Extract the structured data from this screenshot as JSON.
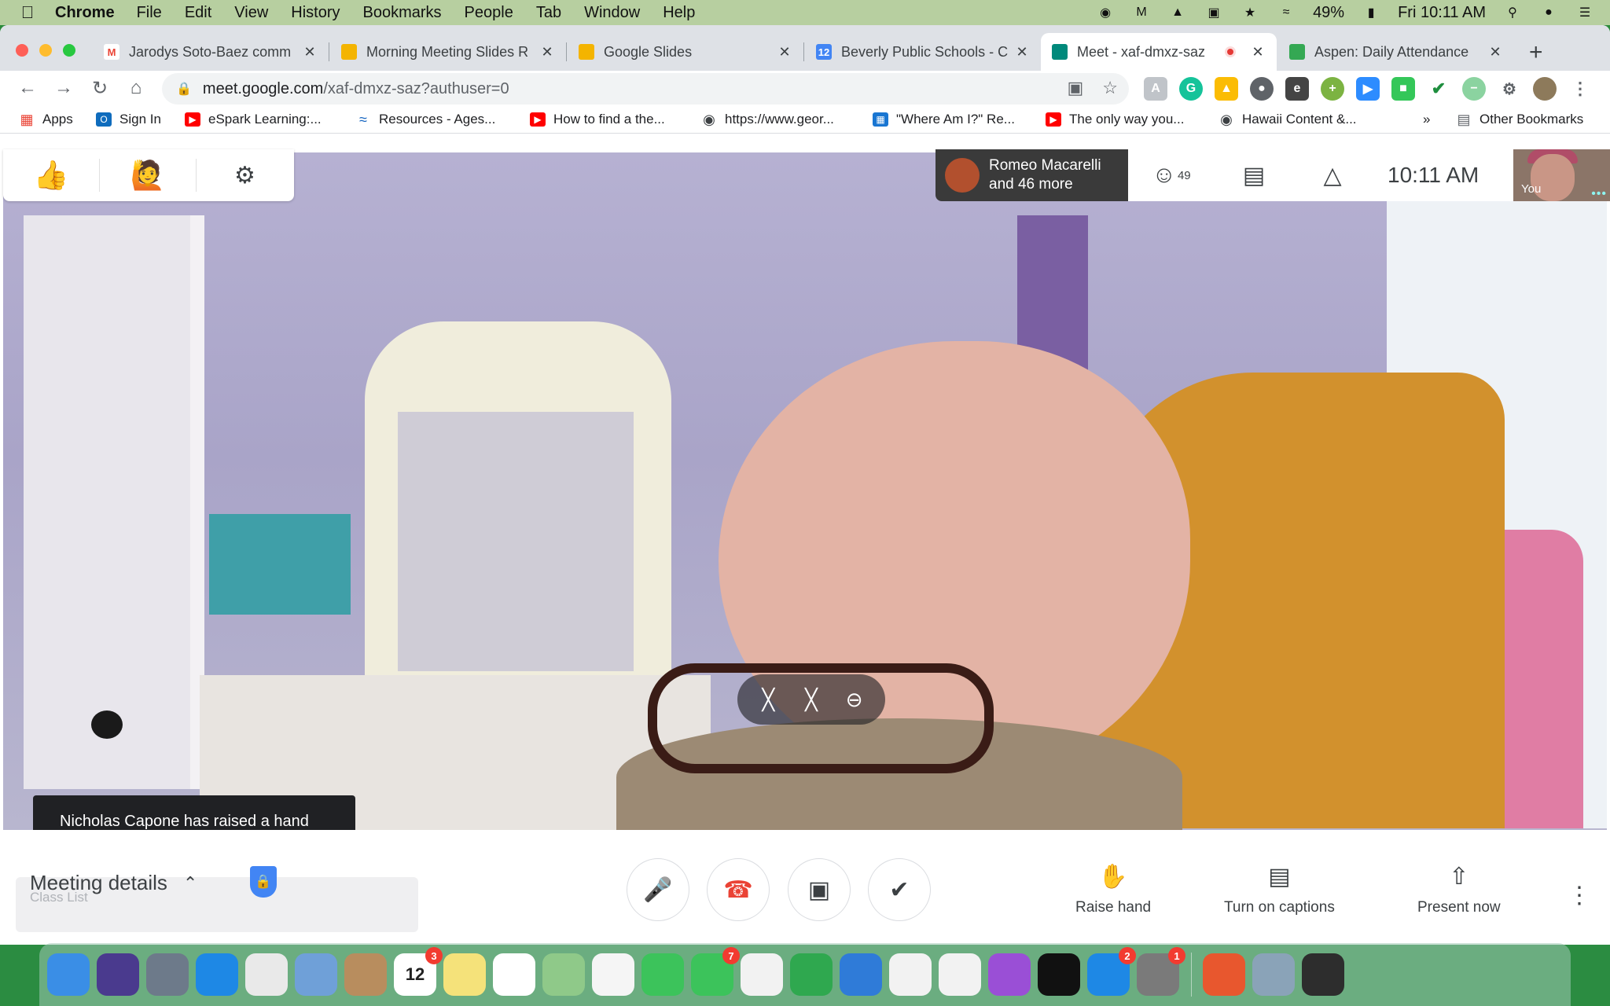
{
  "menubar": {
    "app_name": "Chrome",
    "menus": [
      "File",
      "Edit",
      "View",
      "History",
      "Bookmarks",
      "People",
      "Tab",
      "Window",
      "Help"
    ],
    "battery": "49%",
    "clock": "Fri 10:11 AM"
  },
  "tabs": [
    {
      "title": "Jarodys Soto-Baez comm",
      "favicon": "gmail-icon",
      "color": "#ea4335",
      "glyph": "M"
    },
    {
      "title": "Morning Meeting Slides R",
      "favicon": "slides-icon",
      "color": "#f4b400",
      "glyph": ""
    },
    {
      "title": "Google Slides",
      "favicon": "slides-icon",
      "color": "#f4b400",
      "glyph": ""
    },
    {
      "title": "Beverly Public Schools - C",
      "favicon": "calendar-icon",
      "color": "#4285f4",
      "glyph": "12"
    },
    {
      "title": "Meet - xaf-dmxz-saz",
      "favicon": "meet-icon",
      "color": "#00897b",
      "glyph": ""
    },
    {
      "title": "Aspen: Daily Attendance",
      "favicon": "aspen-icon",
      "color": "#34a853",
      "glyph": ""
    }
  ],
  "address": {
    "host": "meet.google.com",
    "path": "/xaf-dmxz-saz?authuser=0"
  },
  "bookmarks": [
    {
      "label": "Apps",
      "icon": "apps-grid-icon",
      "color": "#ea4335"
    },
    {
      "label": "Sign In",
      "icon": "outlook-icon",
      "color": "#0f6cbd"
    },
    {
      "label": "eSpark Learning:...",
      "icon": "youtube-icon",
      "color": "#ff0000"
    },
    {
      "label": "Resources - Ages...",
      "icon": "wave-icon",
      "color": "#1565c0"
    },
    {
      "label": "How to find a the...",
      "icon": "youtube-icon",
      "color": "#ff0000"
    },
    {
      "label": "https://www.geor...",
      "icon": "globe-icon",
      "color": "#3c4043"
    },
    {
      "label": "\"Where Am I?\" Re...",
      "icon": "building-icon",
      "color": "#1976d2"
    },
    {
      "label": "The only way you...",
      "icon": "youtube-icon",
      "color": "#ff0000"
    },
    {
      "label": "Hawaii Content &...",
      "icon": "circle-icon",
      "color": "#3c4043"
    }
  ],
  "other_bookmarks": "Other Bookmarks",
  "meet": {
    "presenter": "Romeo Macarelli",
    "presenter_more": "and 46 more",
    "participant_count": "49",
    "time": "10:11 AM",
    "self_label": "You",
    "toast": "Nicholas Capone has raised a hand",
    "meeting_details": "Meeting details",
    "ghost_text": "Class List",
    "raise_hand": "Raise hand",
    "captions": "Turn on captions",
    "present": "Present now"
  },
  "dock": [
    {
      "name": "finder-icon",
      "color": "#3a8ee6"
    },
    {
      "name": "siri-icon",
      "color": "#4a3a8e"
    },
    {
      "name": "launchpad-icon",
      "color": "#6d7a8a"
    },
    {
      "name": "safari-icon",
      "color": "#1e88e5"
    },
    {
      "name": "chrome-icon",
      "color": "#e9e9e9"
    },
    {
      "name": "preview-icon",
      "color": "#6fa0d8"
    },
    {
      "name": "contacts-icon",
      "color": "#b88d5e"
    },
    {
      "name": "calendar-icon",
      "color": "#ffffff",
      "label": "12",
      "badge": "3"
    },
    {
      "name": "notes-icon",
      "color": "#f5e27a"
    },
    {
      "name": "reminders-icon",
      "color": "#ffffff"
    },
    {
      "name": "maps-icon",
      "color": "#8fc989"
    },
    {
      "name": "photos-icon",
      "color": "#f5f5f5"
    },
    {
      "name": "messages-icon",
      "color": "#3cc35b"
    },
    {
      "name": "facetime-icon",
      "color": "#3cc35b",
      "badge": "7"
    },
    {
      "name": "freeform-icon",
      "color": "#f2f2f2"
    },
    {
      "name": "numbers-icon",
      "color": "#2fa84f"
    },
    {
      "name": "keynote-icon",
      "color": "#2f7bd8"
    },
    {
      "name": "news-icon",
      "color": "#f2f2f2"
    },
    {
      "name": "music-icon",
      "color": "#f2f2f2"
    },
    {
      "name": "podcasts-icon",
      "color": "#9a4fd6"
    },
    {
      "name": "apple-tv-icon",
      "color": "#111111"
    },
    {
      "name": "app-store-icon",
      "color": "#1e88e5",
      "badge": "2"
    },
    {
      "name": "system-preferences-icon",
      "color": "#7a7a7a",
      "badge": "1"
    },
    {
      "name": "photo-booth-icon",
      "color": "#e8572e"
    },
    {
      "name": "image-capture-icon",
      "color": "#8aa3b8"
    },
    {
      "name": "quicktime-icon",
      "color": "#2d2d2d"
    }
  ],
  "colors": {
    "accent": "#1a73e8",
    "end_call": "#ea4335",
    "toast_bg": "#202124"
  }
}
